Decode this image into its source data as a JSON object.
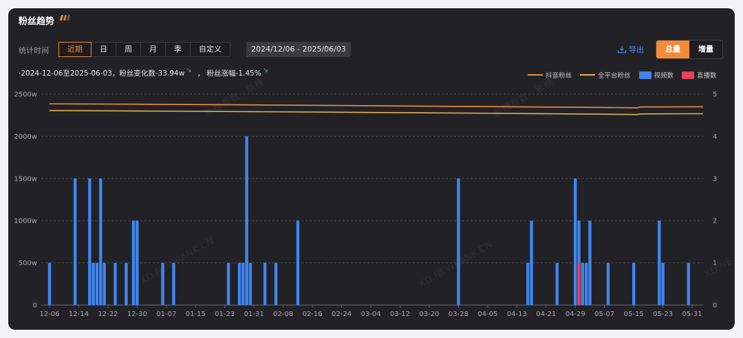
{
  "title": "粉丝趋势",
  "filters": {
    "label": "统计时间",
    "tabs": [
      "近期",
      "日",
      "周",
      "月",
      "季",
      "自定义"
    ],
    "active_tab": "近期",
    "date_range": "2024/12/06  -  2025/06/03"
  },
  "actions": {
    "export_label": "导出",
    "mode_total": "总量",
    "mode_incr": "增量",
    "active_mode": "总量"
  },
  "summary": {
    "text1": "·2024-12-06至2025-06-03，粉丝变化数-33.94w",
    "text2": "，  粉丝涨幅-1.45%"
  },
  "legend": {
    "douyin": "抖音粉丝",
    "allplatform": "全平台粉丝",
    "videos": "视频数",
    "live": "直播数"
  },
  "colors": {
    "douyin": "#f0903c",
    "allplatform": "#e8b050",
    "videos": "#3f86f2",
    "live": "#e8415a",
    "accent": "#f58a3a"
  },
  "watermarks": [
    "新榜有数 · 新榜",
    "新榜有数 · 新榜",
    "XD.NEWRANK.CN",
    "XD.NEWRANK.CN",
    "XD.NE"
  ],
  "chart_data": {
    "type": "bar",
    "x": [
      "12-06",
      "12-07",
      "12-08",
      "12-09",
      "12-10",
      "12-11",
      "12-12",
      "12-13",
      "12-14",
      "12-15",
      "12-16",
      "12-17",
      "12-18",
      "12-19",
      "12-20",
      "12-21",
      "12-22",
      "12-23",
      "12-24",
      "12-25",
      "12-26",
      "12-27",
      "12-28",
      "12-29",
      "12-30",
      "12-31",
      "01-01",
      "01-02",
      "01-03",
      "01-04",
      "01-05",
      "01-06",
      "01-07",
      "01-08",
      "01-09",
      "01-10",
      "01-11",
      "01-12",
      "01-13",
      "01-14",
      "01-15",
      "01-16",
      "01-17",
      "01-18",
      "01-19",
      "01-20",
      "01-21",
      "01-22",
      "01-23",
      "01-24",
      "01-25",
      "01-26",
      "01-27",
      "01-28",
      "01-29",
      "01-30",
      "01-31",
      "02-01",
      "02-02",
      "02-03",
      "02-04",
      "02-05",
      "02-06",
      "02-07",
      "02-08",
      "02-09",
      "02-10",
      "02-11",
      "02-12",
      "02-13",
      "02-14",
      "02-15",
      "02-16",
      "02-17",
      "02-18",
      "02-19",
      "02-20",
      "02-21",
      "02-22",
      "02-23",
      "02-24",
      "02-25",
      "02-26",
      "02-27",
      "02-28",
      "03-01",
      "03-02",
      "03-03",
      "03-04",
      "03-05",
      "03-06",
      "03-07",
      "03-08",
      "03-09",
      "03-10",
      "03-11",
      "03-12",
      "03-13",
      "03-14",
      "03-15",
      "03-16",
      "03-17",
      "03-18",
      "03-19",
      "03-20",
      "03-21",
      "03-22",
      "03-23",
      "03-24",
      "03-25",
      "03-26",
      "03-27",
      "03-28",
      "03-29",
      "03-30",
      "03-31",
      "04-01",
      "04-02",
      "04-03",
      "04-04",
      "04-05",
      "04-06",
      "04-07",
      "04-08",
      "04-09",
      "04-10",
      "04-11",
      "04-12",
      "04-13",
      "04-14",
      "04-15",
      "04-16",
      "04-17",
      "04-18",
      "04-19",
      "04-20",
      "04-21",
      "04-22",
      "04-23",
      "04-24",
      "04-25",
      "04-26",
      "04-27",
      "04-28",
      "04-29",
      "04-30",
      "05-01",
      "05-02",
      "05-03",
      "05-04",
      "05-05",
      "05-06",
      "05-07",
      "05-08",
      "05-09",
      "05-10",
      "05-11",
      "05-12",
      "05-13",
      "05-14",
      "05-15",
      "05-16",
      "05-17",
      "05-18",
      "05-19",
      "05-20",
      "05-21",
      "05-22",
      "05-23",
      "05-24",
      "05-25",
      "05-26",
      "05-27",
      "05-28",
      "05-29",
      "05-30",
      "05-31",
      "06-01",
      "06-02",
      "06-03"
    ],
    "x_tick_labels": [
      "12-06",
      "12-14",
      "12-22",
      "12-30",
      "01-07",
      "01-15",
      "01-23",
      "01-31",
      "02-08",
      "02-16",
      "02-24",
      "03-04",
      "03-12",
      "03-20",
      "03-28",
      "04-05",
      "04-13",
      "04-21",
      "04-29",
      "05-07",
      "05-15",
      "05-23",
      "05-31"
    ],
    "y_left": {
      "ticks": [
        "0",
        "500w",
        "1000w",
        "1500w",
        "2000w",
        "2500w"
      ],
      "ylim": [
        0,
        2500
      ]
    },
    "y_right": {
      "ticks": [
        "0",
        "1",
        "2",
        "3",
        "4",
        "5"
      ],
      "ylim": [
        0,
        5
      ]
    },
    "series": [
      {
        "name": "视频数",
        "axis": "right",
        "kind": "bar",
        "points": [
          [
            "12-06",
            1
          ],
          [
            "12-13",
            3
          ],
          [
            "12-17",
            3
          ],
          [
            "12-18",
            1
          ],
          [
            "12-19",
            1
          ],
          [
            "12-20",
            3
          ],
          [
            "12-21",
            1
          ],
          [
            "12-24",
            1
          ],
          [
            "12-27",
            1
          ],
          [
            "12-29",
            2
          ],
          [
            "12-30",
            2
          ],
          [
            "01-06",
            1
          ],
          [
            "01-09",
            1
          ],
          [
            "01-24",
            1
          ],
          [
            "01-27",
            1
          ],
          [
            "01-28",
            1
          ],
          [
            "01-29",
            4
          ],
          [
            "01-30",
            1
          ],
          [
            "02-03",
            1
          ],
          [
            "02-06",
            1
          ],
          [
            "02-12",
            2
          ],
          [
            "03-28",
            3
          ],
          [
            "04-16",
            1
          ],
          [
            "04-17",
            2
          ],
          [
            "04-24",
            1
          ],
          [
            "04-29",
            3
          ],
          [
            "04-30",
            2
          ],
          [
            "05-01",
            1
          ],
          [
            "05-02",
            1
          ],
          [
            "05-03",
            2
          ],
          [
            "05-08",
            1
          ],
          [
            "05-15",
            1
          ],
          [
            "05-22",
            2
          ],
          [
            "05-23",
            1
          ],
          [
            "05-30",
            1
          ]
        ]
      },
      {
        "name": "直播数",
        "axis": "right",
        "kind": "bar",
        "points": [
          [
            "04-30",
            1
          ]
        ]
      },
      {
        "name": "抖音粉丝",
        "axis": "left",
        "kind": "line",
        "points": [
          [
            "12-06",
            2385
          ],
          [
            "12-30",
            2380
          ],
          [
            "01-31",
            2372
          ],
          [
            "03-04",
            2362
          ],
          [
            "04-05",
            2352
          ],
          [
            "05-07",
            2342
          ],
          [
            "05-16",
            2338
          ],
          [
            "05-17",
            2348
          ],
          [
            "06-03",
            2350
          ]
        ]
      },
      {
        "name": "全平台粉丝",
        "axis": "left",
        "kind": "line",
        "points": [
          [
            "12-06",
            2305
          ],
          [
            "12-30",
            2300
          ],
          [
            "01-31",
            2292
          ],
          [
            "03-04",
            2283
          ],
          [
            "04-05",
            2273
          ],
          [
            "05-07",
            2262
          ],
          [
            "05-16",
            2258
          ],
          [
            "05-17",
            2265
          ],
          [
            "06-03",
            2268
          ]
        ]
      }
    ],
    "grid": true,
    "legend_position": "top-right"
  }
}
